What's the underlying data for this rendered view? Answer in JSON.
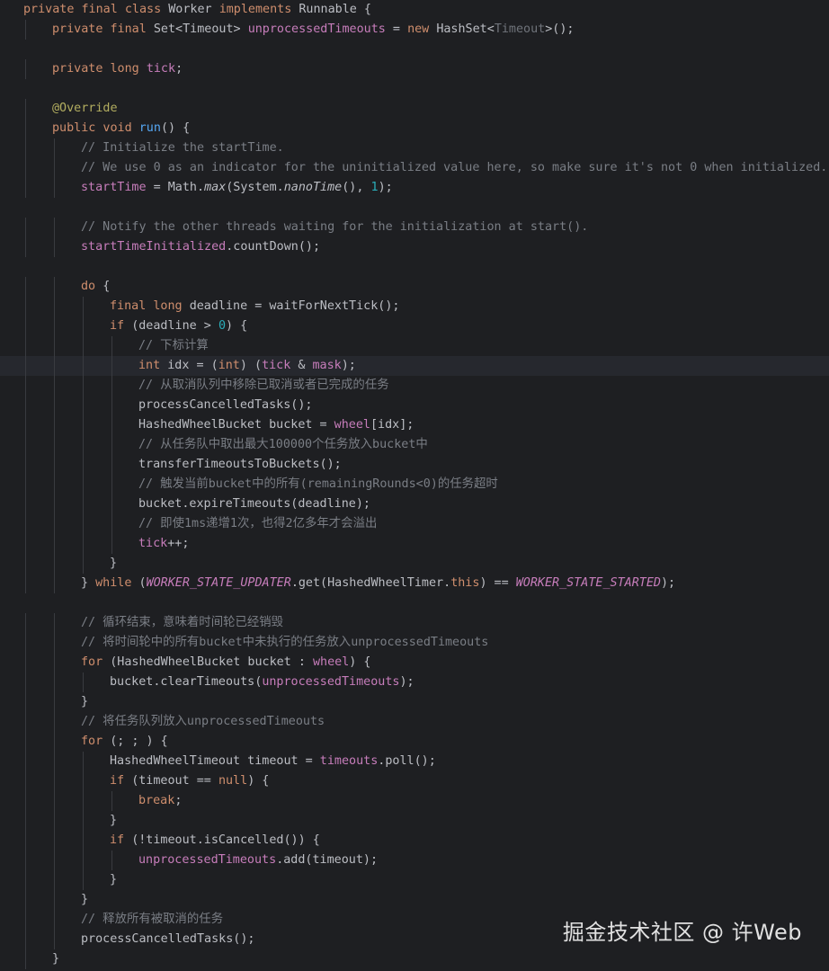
{
  "lines": [
    {
      "indent": 0,
      "spans": [
        [
          "kw",
          "private final class "
        ],
        [
          "",
          "Worker "
        ],
        [
          "kw",
          "implements "
        ],
        [
          "",
          "Runnable {"
        ]
      ]
    },
    {
      "indent": 1,
      "spans": [
        [
          "kw",
          "private final "
        ],
        [
          "",
          "Set<Timeout> "
        ],
        [
          "fld",
          "unprocessedTimeouts"
        ],
        [
          "",
          " = "
        ],
        [
          "kw",
          "new "
        ],
        [
          "",
          "HashSet<"
        ],
        [
          "gen",
          "Timeout"
        ],
        [
          "",
          ">();"
        ]
      ]
    },
    {
      "indent": 0,
      "spans": []
    },
    {
      "indent": 1,
      "spans": [
        [
          "kw",
          "private long "
        ],
        [
          "fld",
          "tick"
        ],
        [
          "",
          ";"
        ]
      ]
    },
    {
      "indent": 0,
      "spans": []
    },
    {
      "indent": 1,
      "spans": [
        [
          "ann",
          "@Override"
        ]
      ]
    },
    {
      "indent": 1,
      "spans": [
        [
          "kw",
          "public void "
        ],
        [
          "fn",
          "run"
        ],
        [
          "",
          "() {"
        ]
      ]
    },
    {
      "indent": 2,
      "spans": [
        [
          "com",
          "// Initialize the startTime."
        ]
      ]
    },
    {
      "indent": 2,
      "spans": [
        [
          "com",
          "// We use 0 as an indicator for the uninitialized value here, so make sure it's not 0 when initialized."
        ]
      ]
    },
    {
      "indent": 2,
      "spans": [
        [
          "fld",
          "startTime"
        ],
        [
          "",
          " = Math."
        ],
        [
          "ital",
          "max"
        ],
        [
          "",
          "(System."
        ],
        [
          "ital",
          "nanoTime"
        ],
        [
          "",
          "(), "
        ],
        [
          "num",
          "1"
        ],
        [
          "",
          ");"
        ]
      ]
    },
    {
      "indent": 0,
      "spans": []
    },
    {
      "indent": 2,
      "spans": [
        [
          "com",
          "// Notify the other threads waiting for the initialization at start()."
        ]
      ]
    },
    {
      "indent": 2,
      "spans": [
        [
          "fld",
          "startTimeInitialized"
        ],
        [
          "",
          ".countDown();"
        ]
      ]
    },
    {
      "indent": 0,
      "spans": []
    },
    {
      "indent": 2,
      "spans": [
        [
          "kw",
          "do "
        ],
        [
          "",
          "{"
        ]
      ]
    },
    {
      "indent": 3,
      "spans": [
        [
          "kw",
          "final long "
        ],
        [
          "",
          "deadline = waitForNextTick();"
        ]
      ]
    },
    {
      "indent": 3,
      "spans": [
        [
          "kw",
          "if "
        ],
        [
          "",
          "(deadline > "
        ],
        [
          "num",
          "0"
        ],
        [
          "",
          ") {"
        ]
      ]
    },
    {
      "indent": 4,
      "spans": [
        [
          "com",
          "// 下标计算"
        ]
      ]
    },
    {
      "indent": 4,
      "current": true,
      "spans": [
        [
          "kw",
          "int "
        ],
        [
          "",
          "idx = ("
        ],
        [
          "kw",
          "int"
        ],
        [
          "",
          ") ("
        ],
        [
          "fld",
          "tick"
        ],
        [
          "",
          " & "
        ],
        [
          "fld",
          "mask"
        ],
        [
          "",
          ");"
        ]
      ]
    },
    {
      "indent": 4,
      "spans": [
        [
          "com",
          "// 从取消队列中移除已取消或者已完成的任务"
        ]
      ]
    },
    {
      "indent": 4,
      "spans": [
        [
          "",
          "processCancelledTasks();"
        ]
      ]
    },
    {
      "indent": 4,
      "spans": [
        [
          "",
          "HashedWheelBucket bucket = "
        ],
        [
          "fld",
          "wheel"
        ],
        [
          "",
          "[idx];"
        ]
      ]
    },
    {
      "indent": 4,
      "spans": [
        [
          "com",
          "// 从任务队中取出最大100000个任务放入bucket中"
        ]
      ]
    },
    {
      "indent": 4,
      "spans": [
        [
          "",
          "transferTimeoutsToBuckets();"
        ]
      ]
    },
    {
      "indent": 4,
      "spans": [
        [
          "com",
          "// 触发当前bucket中的所有(remainingRounds<0)的任务超时"
        ]
      ]
    },
    {
      "indent": 4,
      "spans": [
        [
          "",
          "bucket.expireTimeouts(deadline);"
        ]
      ]
    },
    {
      "indent": 4,
      "spans": [
        [
          "com",
          "// 即使1ms递增1次，也得2亿多年才会溢出"
        ]
      ]
    },
    {
      "indent": 4,
      "spans": [
        [
          "fld",
          "tick"
        ],
        [
          "",
          "++;"
        ]
      ]
    },
    {
      "indent": 3,
      "spans": [
        [
          "",
          "}"
        ]
      ]
    },
    {
      "indent": 2,
      "spans": [
        [
          "",
          "} "
        ],
        [
          "kw",
          "while "
        ],
        [
          "",
          "("
        ],
        [
          "const",
          "WORKER_STATE_UPDATER"
        ],
        [
          "",
          ".get(HashedWheelTimer."
        ],
        [
          "kw",
          "this"
        ],
        [
          "",
          ") == "
        ],
        [
          "const",
          "WORKER_STATE_STARTED"
        ],
        [
          "",
          ");"
        ]
      ]
    },
    {
      "indent": 0,
      "spans": []
    },
    {
      "indent": 2,
      "spans": [
        [
          "com",
          "// 循环结束，意味着时间轮已经销毁"
        ]
      ]
    },
    {
      "indent": 2,
      "spans": [
        [
          "com",
          "// 将时间轮中的所有bucket中未执行的任务放入unprocessedTimeouts"
        ]
      ]
    },
    {
      "indent": 2,
      "spans": [
        [
          "kw",
          "for "
        ],
        [
          "",
          "(HashedWheelBucket bucket : "
        ],
        [
          "fld",
          "wheel"
        ],
        [
          "",
          ") {"
        ]
      ]
    },
    {
      "indent": 3,
      "spans": [
        [
          "",
          "bucket.clearTimeouts("
        ],
        [
          "fld",
          "unprocessedTimeouts"
        ],
        [
          "",
          ");"
        ]
      ]
    },
    {
      "indent": 2,
      "spans": [
        [
          "",
          "}"
        ]
      ]
    },
    {
      "indent": 2,
      "spans": [
        [
          "com",
          "// 将任务队列放入unprocessedTimeouts"
        ]
      ]
    },
    {
      "indent": 2,
      "spans": [
        [
          "kw",
          "for "
        ],
        [
          "",
          "(; ; ) {"
        ]
      ]
    },
    {
      "indent": 3,
      "spans": [
        [
          "",
          "HashedWheelTimeout timeout = "
        ],
        [
          "fld",
          "timeouts"
        ],
        [
          "",
          ".poll();"
        ]
      ]
    },
    {
      "indent": 3,
      "spans": [
        [
          "kw",
          "if "
        ],
        [
          "",
          "(timeout == "
        ],
        [
          "kw",
          "null"
        ],
        [
          "",
          ") {"
        ]
      ]
    },
    {
      "indent": 4,
      "spans": [
        [
          "kw",
          "break"
        ],
        [
          "",
          ";"
        ]
      ]
    },
    {
      "indent": 3,
      "spans": [
        [
          "",
          "}"
        ]
      ]
    },
    {
      "indent": 3,
      "spans": [
        [
          "kw",
          "if "
        ],
        [
          "",
          "(!timeout.isCancelled()) {"
        ]
      ]
    },
    {
      "indent": 4,
      "spans": [
        [
          "fld",
          "unprocessedTimeouts"
        ],
        [
          "",
          ".add(timeout);"
        ]
      ]
    },
    {
      "indent": 3,
      "spans": [
        [
          "",
          "}"
        ]
      ]
    },
    {
      "indent": 2,
      "spans": [
        [
          "",
          "}"
        ]
      ]
    },
    {
      "indent": 2,
      "spans": [
        [
          "com",
          "// 释放所有被取消的任务"
        ]
      ]
    },
    {
      "indent": 2,
      "spans": [
        [
          "",
          "processCancelledTasks();"
        ]
      ]
    },
    {
      "indent": 1,
      "spans": [
        [
          "",
          "}"
        ]
      ]
    }
  ],
  "watermark": "掘金技术社区 @ 许Web"
}
